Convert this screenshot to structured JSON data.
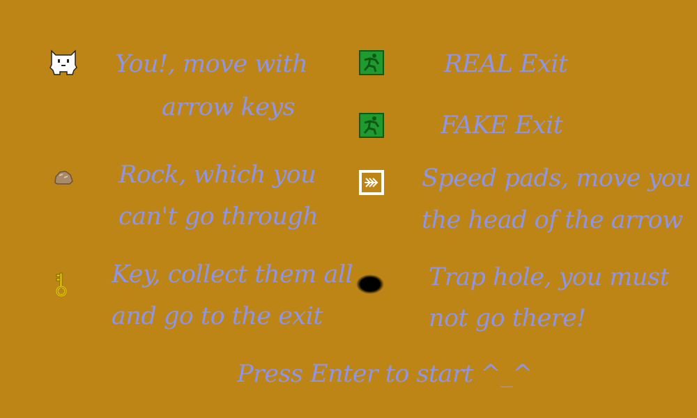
{
  "legend": {
    "player": {
      "icon": "cat-player-icon",
      "line1": "You!, move with",
      "line2": "arrow keys"
    },
    "rock": {
      "icon": "rock-icon",
      "line1": "Rock, which you",
      "line2": "can't go through"
    },
    "key": {
      "icon": "key-icon",
      "line1": "Key, collect them all",
      "line2": "and go to the exit"
    },
    "real_exit": {
      "icon": "exit-runner-icon",
      "label": "REAL Exit"
    },
    "fake_exit": {
      "icon": "exit-runner-icon",
      "label": "FAKE Exit"
    },
    "speed_pad": {
      "icon": "speed-arrow-icon",
      "line1": "Speed pads, move you",
      "line2": "the head of the arrow"
    },
    "trap": {
      "icon": "trap-hole-icon",
      "line1": "Trap hole, you must",
      "line2": "not go there!"
    }
  },
  "start_prompt": "Press Enter to start ^_^",
  "colors": {
    "background": "#bd8516",
    "text": "#8e95e6",
    "exit_green": "#1f9a2e"
  }
}
